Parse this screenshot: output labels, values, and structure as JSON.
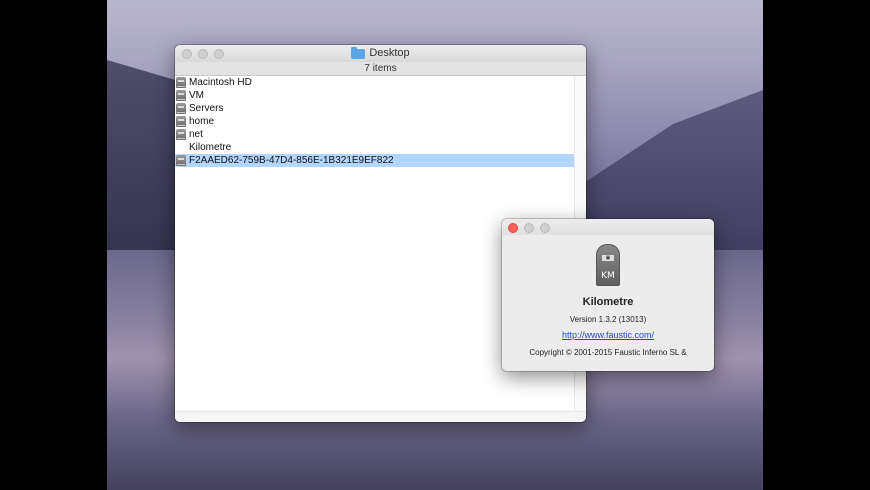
{
  "finder": {
    "title": "Desktop",
    "status": "7 items",
    "items": [
      {
        "label": "Macintosh HD",
        "icon": "disk-icon"
      },
      {
        "label": "VM",
        "icon": "disk-icon"
      },
      {
        "label": "Servers",
        "icon": "disk-icon"
      },
      {
        "label": "home",
        "icon": "disk-icon"
      },
      {
        "label": "net",
        "icon": "disk-icon"
      },
      {
        "label": "Kilometre",
        "icon": ""
      },
      {
        "label": "F2AAED62-759B-47D4-856E-1B321E9EF822",
        "icon": "disk-icon",
        "selected": true
      }
    ]
  },
  "about": {
    "icon_text": "KM",
    "app_name": "Kilometre",
    "version": "Version 1.3.2 (13013)",
    "link": "http://www.faustic.com/",
    "copyright": "Copyright © 2001-2015 Faustic Inferno SL &"
  },
  "colors": {
    "selection": "#b4d5fe",
    "close_button": "#fc605b",
    "link": "#1a4dd1",
    "folder": "#5aa7e8"
  }
}
